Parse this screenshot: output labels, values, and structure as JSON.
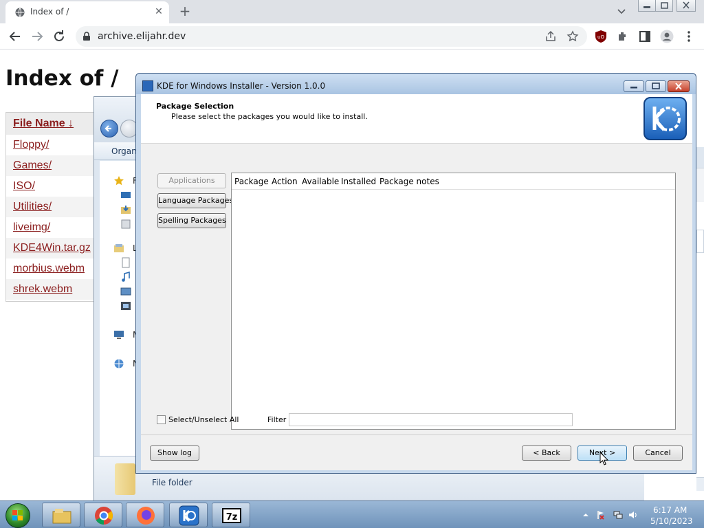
{
  "browser": {
    "tab_title": "Index of /",
    "url": "archive.elijahr.dev",
    "icons": [
      "back-icon",
      "forward-icon",
      "reload-icon",
      "lock-icon",
      "share-icon",
      "star-icon",
      "ublock-icon",
      "extensions-icon",
      "sidebar-icon",
      "profile-icon",
      "menu-icon"
    ]
  },
  "page": {
    "title": "Index of /",
    "listing": {
      "header": "File Name  ↓",
      "rows": [
        "Floppy/",
        "Games/",
        "ISO/",
        "Utilities/",
        "liveimg/",
        "KDE4Win.tar.gz",
        "morbius.webm",
        "shrek.webm"
      ]
    },
    "link_color": "#8b1e1e"
  },
  "explorer": {
    "command_label": "Organi",
    "nav_labels": [
      "Fa",
      "Lib",
      "My",
      "Ne"
    ],
    "status_text": "File folder"
  },
  "installer": {
    "title": "KDE for Windows Installer - Version 1.0.0",
    "header_title": "Package Selection",
    "header_subtitle": "Please select the packages you would like to install.",
    "categories": [
      "Applications",
      "Language Packages",
      "Spelling Packages"
    ],
    "columns": [
      "Package",
      "Action",
      "Available",
      "Installed",
      "Package notes"
    ],
    "select_all_label": "Select/Unselect All",
    "select_all_checked": false,
    "filter_label": "Filter",
    "filter_value": "",
    "buttons": {
      "show_log": "Show log",
      "back": "< Back",
      "next": "Next >",
      "cancel": "Cancel"
    }
  },
  "taskbar": {
    "apps": [
      "explorer-icon",
      "chrome-icon",
      "firefox-icon",
      "kde-icon",
      "7zip-icon"
    ],
    "time": "6:17 AM",
    "date": "5/10/2023"
  }
}
